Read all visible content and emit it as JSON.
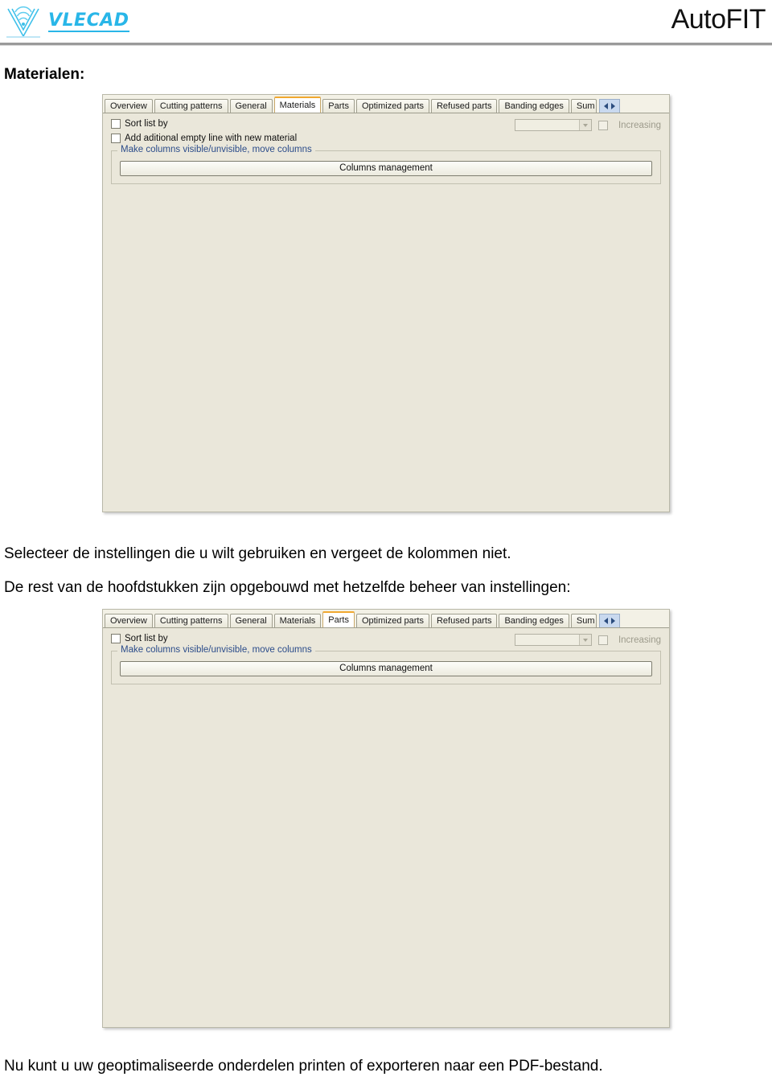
{
  "header": {
    "logo_text": "VLECAD",
    "logo_icon": "vlecad-fan-logo",
    "product_title": "AutoFIT"
  },
  "body_text": {
    "section_label": "Materialen:",
    "para_1": "Selecteer de instellingen die u wilt gebruiken en vergeet de kolommen niet.",
    "para_2": "De rest van de hoofdstukken zijn opgebouwd met hetzelfde beheer van instellingen:",
    "para_3": "Nu kunt u uw geoptimaliseerde onderdelen printen of exporteren naar een PDF-bestand."
  },
  "colors": {
    "panel_background": "#EAE7DA",
    "active_tab_accent": "#F0A830",
    "legend_text": "#2B4C8A",
    "logo_cyan": "#29B6E8",
    "tab_nav_background": "#C9D9EF"
  },
  "screenshot_materials": {
    "tabs": [
      {
        "label": "Overview",
        "active": false
      },
      {
        "label": "Cutting patterns",
        "active": false
      },
      {
        "label": "General",
        "active": false
      },
      {
        "label": "Materials",
        "active": true
      },
      {
        "label": "Parts",
        "active": false
      },
      {
        "label": "Optimized parts",
        "active": false
      },
      {
        "label": "Refused parts",
        "active": false
      },
      {
        "label": "Banding edges",
        "active": false
      },
      {
        "label": "Sum",
        "active": false
      }
    ],
    "nav_prev_icon": "chevron-left-icon",
    "nav_next_icon": "chevron-right-icon",
    "sort_list_by_label": "Sort list by",
    "sort_list_by_checked": false,
    "sort_combo_value": "",
    "sort_combo_icon": "chevron-down-icon",
    "increasing_label": "Increasing",
    "increasing_checked": false,
    "add_line_label": "Add aditional empty line with new material",
    "add_line_checked": false,
    "group_legend": "Make columns visible/unvisible, move columns",
    "columns_button_label": "Columns management"
  },
  "screenshot_parts": {
    "tabs": [
      {
        "label": "Overview",
        "active": false
      },
      {
        "label": "Cutting patterns",
        "active": false
      },
      {
        "label": "General",
        "active": false
      },
      {
        "label": "Materials",
        "active": false
      },
      {
        "label": "Parts",
        "active": true
      },
      {
        "label": "Optimized parts",
        "active": false
      },
      {
        "label": "Refused parts",
        "active": false
      },
      {
        "label": "Banding edges",
        "active": false
      },
      {
        "label": "Sum",
        "active": false
      }
    ],
    "nav_prev_icon": "chevron-left-icon",
    "nav_next_icon": "chevron-right-icon",
    "sort_list_by_label": "Sort list by",
    "sort_list_by_checked": false,
    "sort_combo_value": "",
    "sort_combo_icon": "chevron-down-icon",
    "increasing_label": "Increasing",
    "increasing_checked": false,
    "group_legend": "Make columns visible/unvisible, move columns",
    "columns_button_label": "Columns management"
  }
}
